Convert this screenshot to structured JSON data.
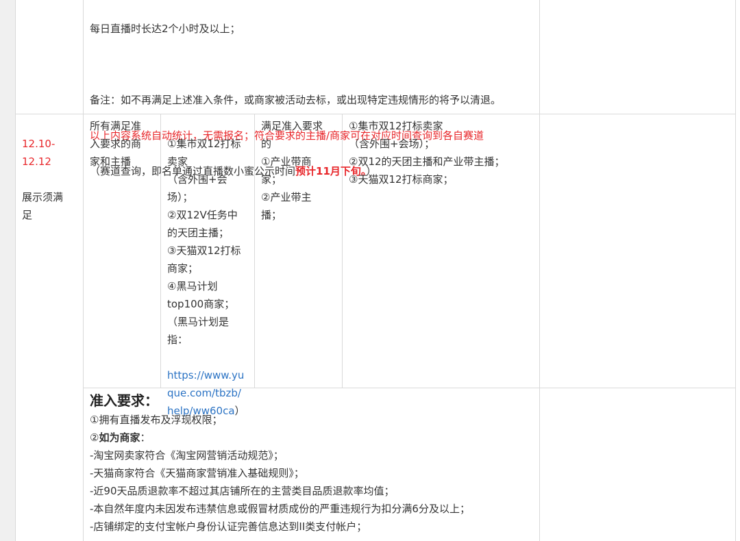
{
  "top_section": {
    "line1": "每日直播时长达2个小时及以上；",
    "note": "备注：如不再满足上述准入条件，或商家被活动去标，或出现特定违规情形的将予以清退。",
    "red_text": "以上内容系统自动统计，无需报名；符合要求的主播/商家可在对应时间查询到各自赛道",
    "paren_open": "（赛道查询，即名单通过直播数小蜜公示时间",
    "red_bold": "预计11月下旬。",
    "paren_close": "）"
  },
  "row": {
    "date": "12.10-\n12.12",
    "date_note": "展示须满\n足",
    "scope": "所有满足准\n入要求的商\n家和主播",
    "list_a": "①集市双12打标\n卖家\n（含外围+会\n场）；\n②双12V任务中\n的天团主播；\n③天猫双12打标\n商家；\n④黑马计划\ntop100商家；\n（黑马计划是\n指：",
    "link": "https://www.yu\nque.com/tbzb/\nhelp/ww60ca",
    "link_close": "）",
    "list_b": "满足准入要求\n的\n①产业带商\n家；\n②产业带主\n播；",
    "list_c": "①集市双12打标卖家\n（含外围+会场）；\n②双12的天团主播和产业带主播；\n③天猫双12打标商家；"
  },
  "requirements": {
    "heading": "准入要求：",
    "item1": "①拥有直播发布及浮现权限；",
    "item2_prefix": "②",
    "item2_bold": "如为商家",
    "item2_suffix": "：",
    "lines": [
      "-淘宝网卖家符合《淘宝网营销活动规范》；",
      "-天猫商家符合《天猫商家营销准入基础规则》；",
      "-近90天品质退款率不超过其店铺所在的主营类目品质退款率均值；",
      "-本自然年度内未因发布违禁信息或假冒材质成份的严重违规行为扣分满6分及以上；",
      "-店铺绑定的支付宝帐户身份认证完善信息达到II类支付帐户；"
    ]
  }
}
